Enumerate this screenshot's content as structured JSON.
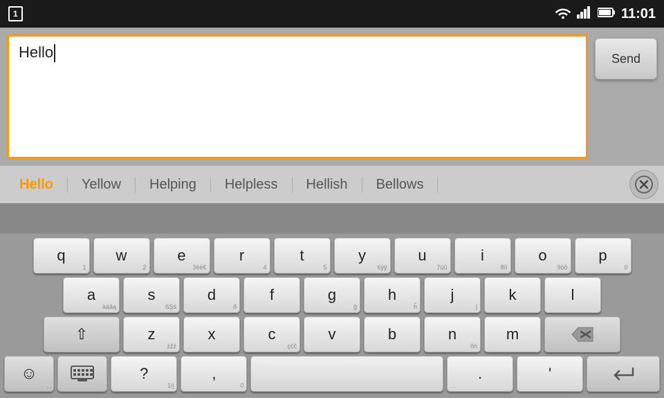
{
  "status_bar": {
    "notification": "1",
    "time": "11:01",
    "wifi_icon": "wifi",
    "signal_icon": "signal",
    "battery_icon": "battery"
  },
  "text_input": {
    "value": "Hello",
    "placeholder": ""
  },
  "send_button": {
    "label": "Send"
  },
  "suggestions": [
    {
      "text": "Hello",
      "active": true
    },
    {
      "text": "Yellow",
      "active": false
    },
    {
      "text": "Helping",
      "active": false
    },
    {
      "text": "Helpless",
      "active": false
    },
    {
      "text": "Hellish",
      "active": false
    },
    {
      "text": "Bellows",
      "active": false
    }
  ],
  "keyboard": {
    "rows": [
      [
        "q",
        "w",
        "e",
        "r",
        "t",
        "y",
        "u",
        "i",
        "o",
        "p"
      ],
      [
        "a",
        "s",
        "d",
        "f",
        "g",
        "h",
        "j",
        "k",
        "l"
      ],
      [
        "z",
        "x",
        "c",
        "v",
        "b",
        "n",
        "m"
      ],
      [
        "?",
        "'",
        ",",
        "space",
        ".",
        "↵"
      ]
    ],
    "sub_labels": {
      "q": "1",
      "w": "2",
      "e": "3ëè€",
      "r": "4",
      "t": "5",
      "y": "6ÿŷ",
      "u": "7üû",
      "i": "8ïî",
      "o": "9öô",
      "p": "0",
      "a": "àäâą",
      "s": "ßẞś",
      "d": "ð",
      "f": "",
      "g": "ĝ",
      "h": "ĥ",
      "j": "ĵ",
      "k": "",
      "l": "",
      "z": "żžź",
      "x": "",
      "c": "çćĉ",
      "v": "",
      "b": "",
      "n": "ñń",
      "m": ""
    }
  }
}
